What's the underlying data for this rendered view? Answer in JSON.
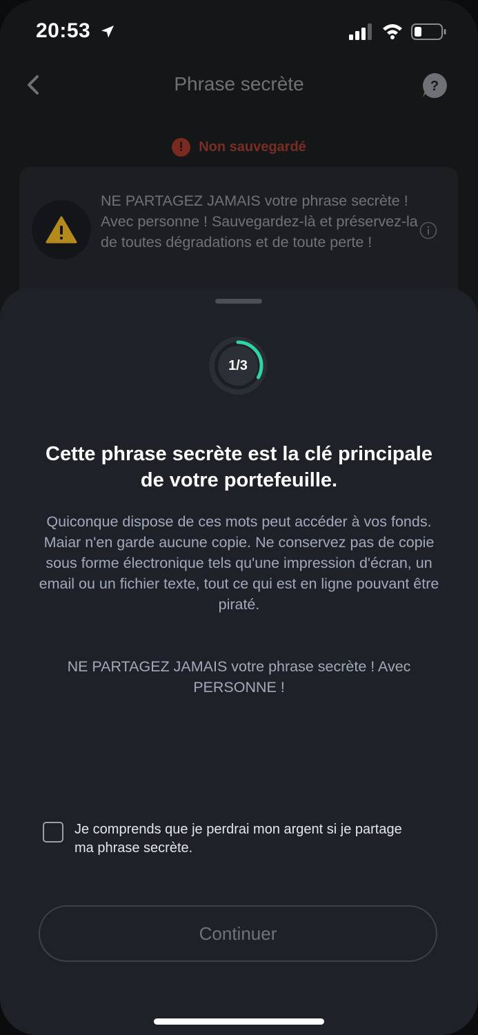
{
  "status_bar": {
    "time": "20:53",
    "icons": [
      "location-arrow-icon",
      "signal-icon",
      "wifi-icon",
      "battery-icon"
    ]
  },
  "header": {
    "title": "Phrase secrète",
    "back_icon": "chevron-left-icon",
    "help_icon": "help-bubble-icon"
  },
  "status_badge": {
    "icon": "!",
    "text": "Non sauvegardé",
    "color": "#7a2d22"
  },
  "warning_card": {
    "icon": "warning-triangle-icon",
    "text": "NE PARTAGEZ JAMAIS votre phrase secrète ! Avec personne ! Sauvegardez-là et préservez-la de toutes dégradations et de toute perte !"
  },
  "sheet": {
    "progress": {
      "label": "1/3",
      "fraction": 0.333,
      "color": "#2fd3a8"
    },
    "title": "Cette phrase secrète est la clé principale de votre portefeuille.",
    "description": "Quiconque dispose de ces mots peut accéder à vos fonds. Maiar n'en garde aucune copie. Ne conservez pas de copie sous forme électronique tels qu'une impression d'écran, un email ou un fichier texte, tout ce qui est en ligne pouvant être piraté.",
    "warning": "NE PARTAGEZ JAMAIS votre phrase secrète ! Avec PERSONNE !",
    "checkbox_label": "Je comprends que je perdrai mon argent si je partage ma phrase secrète.",
    "checkbox_checked": false,
    "continue_label": "Continuer"
  }
}
